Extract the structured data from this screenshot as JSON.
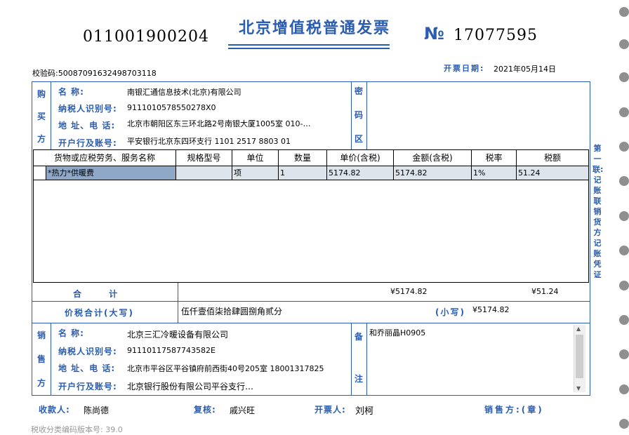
{
  "header": {
    "invoice_code": "011001900204",
    "title": "北京增值税普通发票",
    "no_mark": "№",
    "invoice_number": "17077595",
    "check_code_label": "校验码:",
    "check_code": "50087091632498703118",
    "issue_date_label": "开票日期:",
    "issue_date": "2021年05月14日"
  },
  "buyer": {
    "side_label": [
      "购",
      "买",
      "方"
    ],
    "name_label": "名      称:",
    "name": "南银汇通信息技术(北京)有限公司",
    "taxid_label": "纳税人识别号:",
    "taxid": "9111010578550278X0",
    "addr_label": "地 址、电 话:",
    "addr": "北京市朝阳区东三环北路2号南银大厦1005室  010-…",
    "bank_label": "开户行及账号:",
    "bank": "平安银行北京东四环支行 1101 2517 8803 01"
  },
  "cipher_label": [
    "密",
    "码",
    "区"
  ],
  "items": {
    "headers": [
      "货物或应税劳务、服务名称",
      "规格型号",
      "单位",
      "数量",
      "单价(含税)",
      "金额(含税)",
      "税率",
      "税额"
    ],
    "rows": [
      [
        "*热力*供暖费",
        "",
        "项",
        "1",
        "5174.82",
        "5174.82",
        "1%",
        "51.24"
      ]
    ]
  },
  "totals": {
    "label": "合      计",
    "amount": "¥5174.82",
    "tax": "¥51.24",
    "total_label": "价税合计(大写)",
    "total_words": "伍仟壹佰柒拾肆圆捌角贰分",
    "small_label": "(小写)",
    "total_small": "¥5174.82"
  },
  "seller": {
    "side_label": [
      "销",
      "售",
      "方"
    ],
    "name_label": "名      称:",
    "name": "北京三汇冷暖设备有限公司",
    "taxid_label": "纳税人识别号:",
    "taxid": "91110117587743582E",
    "addr_label": "地 址、电 话:",
    "addr": "北京市平谷区平谷镇府前西街40号205室  18001317825",
    "bank_label": "开户行及账号:",
    "bank": "北京银行股份有限公司平谷支行…"
  },
  "remarks": {
    "label": [
      "备",
      "注"
    ],
    "text": "和乔丽晶H0905"
  },
  "copy_label": "第一联:记账联 销货方记账凭证",
  "footer": {
    "payee_label": "收款人:",
    "payee": "陈尚德",
    "reviewer_label": "复核:",
    "reviewer": "戚兴旺",
    "drawer_label": "开票人:",
    "drawer": "刘柯",
    "seller_label": "销售方:(章)",
    "version": "税收分类编码版本号: 39.0"
  },
  "colors": {
    "accent": "#2a5db0",
    "selected_cell": "#8fa8c7",
    "row_bg": "#dde4ec"
  }
}
